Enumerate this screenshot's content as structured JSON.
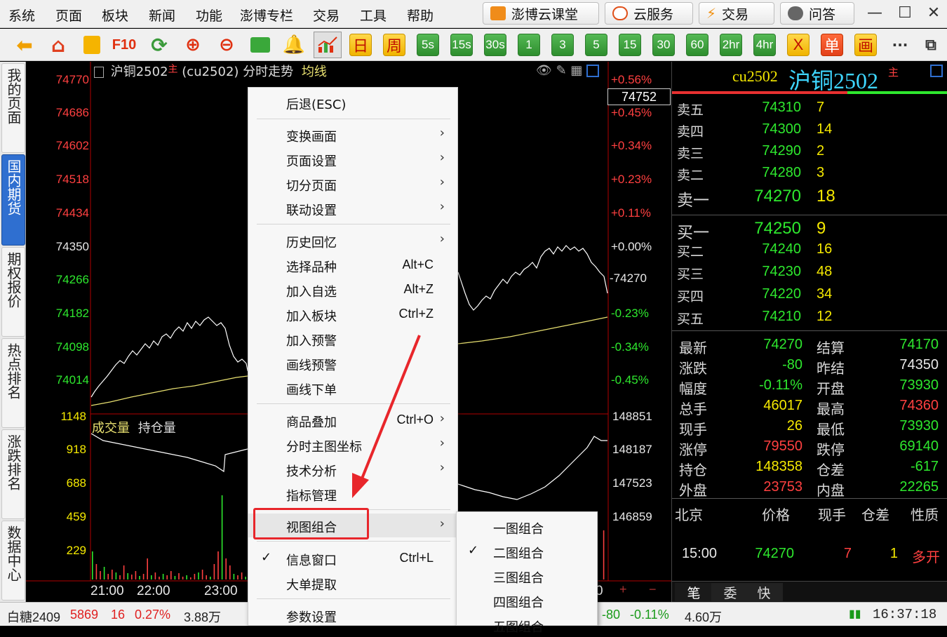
{
  "menubar": {
    "items": [
      "系统",
      "页面",
      "板块",
      "新闻",
      "功能",
      "澎博专栏",
      "交易",
      "工具",
      "帮助"
    ],
    "buttons": [
      "澎博云课堂",
      "云服务",
      "交易",
      "问答"
    ]
  },
  "toolbar": {
    "f10": "F10",
    "periods": [
      "日",
      "周",
      "5s",
      "15s",
      "30s",
      "1",
      "3",
      "5",
      "15",
      "30",
      "60",
      "2hr",
      "4hr"
    ],
    "icons_right": [
      "X",
      "单",
      "画"
    ],
    "more": "···"
  },
  "lefttabs": [
    "我的页面",
    "国内期货",
    "期权报价",
    "热点排名",
    "涨跌排名",
    "数据中心"
  ],
  "chart": {
    "title_prefix": "沪铜2502",
    "title_main_tag": "主",
    "title_suffix": "(cu2502) 分时走势",
    "avg_label": "均线",
    "price_labels": [
      "74770",
      "74686",
      "74602",
      "74518",
      "74434",
      "74350",
      "74266",
      "74182",
      "74098",
      "74014"
    ],
    "pct_labels": [
      "+0.56%",
      "+0.45%",
      "+0.34%",
      "+0.23%",
      "+0.11%",
      "+0.00%",
      "-0.23%",
      "-0.34%",
      "-0.45%"
    ],
    "current_price_box": "74752",
    "last_price_marker": "74270",
    "vol_title_a": "成交量",
    "vol_title_b": "持仓量",
    "vol_labels": [
      "1148",
      "918",
      "688",
      "459",
      "229"
    ],
    "oi_labels": [
      "148851",
      "148187",
      "147523",
      "146859"
    ],
    "time_labels": [
      "21:00",
      "22:00",
      "23:00"
    ],
    "time_label_right": "0",
    "plus_minus": [
      "+",
      "−"
    ]
  },
  "quote": {
    "code": "cu2502",
    "name": "沪铜2502",
    "main_tag": "主",
    "asks": [
      {
        "label": "卖五",
        "price": "74310",
        "qty": "7"
      },
      {
        "label": "卖四",
        "price": "74300",
        "qty": "14"
      },
      {
        "label": "卖三",
        "price": "74290",
        "qty": "2"
      },
      {
        "label": "卖二",
        "price": "74280",
        "qty": "3"
      },
      {
        "label": "卖一",
        "price": "74270",
        "qty": "18"
      }
    ],
    "bids": [
      {
        "label": "买一",
        "price": "74250",
        "qty": "9"
      },
      {
        "label": "买二",
        "price": "74240",
        "qty": "16"
      },
      {
        "label": "买三",
        "price": "74230",
        "qty": "48"
      },
      {
        "label": "买四",
        "price": "74220",
        "qty": "34"
      },
      {
        "label": "买五",
        "price": "74210",
        "qty": "12"
      }
    ],
    "stats": [
      {
        "l1": "最新",
        "v1": "74270",
        "c1": "#2ee82e",
        "l2": "结算",
        "v2": "74170",
        "c2": "#2ee82e"
      },
      {
        "l1": "涨跌",
        "v1": "-80",
        "c1": "#2ee82e",
        "l2": "昨结",
        "v2": "74350",
        "c2": "#e8e8e8"
      },
      {
        "l1": "幅度",
        "v1": "-0.11%",
        "c1": "#2ee82e",
        "l2": "开盘",
        "v2": "73930",
        "c2": "#2ee82e"
      },
      {
        "l1": "总手",
        "v1": "46017",
        "c1": "#f5e900",
        "l2": "最高",
        "v2": "74360",
        "c2": "#ff4040"
      },
      {
        "l1": "现手",
        "v1": "26",
        "c1": "#f5e900",
        "l2": "最低",
        "v2": "73930",
        "c2": "#2ee82e"
      },
      {
        "l1": "涨停",
        "v1": "79550",
        "c1": "#ff4040",
        "l2": "跌停",
        "v2": "69140",
        "c2": "#2ee82e"
      },
      {
        "l1": "持仓",
        "v1": "148358",
        "c1": "#f5e900",
        "l2": "仓差",
        "v2": "-617",
        "c2": "#2ee82e"
      },
      {
        "l1": "外盘",
        "v1": "23753",
        "c1": "#ff4040",
        "l2": "内盘",
        "v2": "22265",
        "c2": "#2ee82e"
      }
    ],
    "tick_header": [
      "北京",
      "价格",
      "现手",
      "仓差",
      "性质"
    ],
    "tick_row": {
      "time": "15:00",
      "price": "74270",
      "qty": "7",
      "oi": "1",
      "nature": "多开"
    },
    "bottom_tabs": [
      "笔",
      "委",
      "快"
    ]
  },
  "status": {
    "left_name": "白糖2409",
    "left_price": "5869",
    "left_change": "16",
    "left_pct": "0.27%",
    "left_vol": "3.88万",
    "mid_change": "-80",
    "mid_pct": "-0.11%",
    "mid_vol": "4.60万",
    "clock": "16:37:18"
  },
  "ctxmenu": {
    "items": [
      {
        "label": "后退(ESC)",
        "sc": "",
        "arrow": false,
        "check": false
      },
      {
        "label": "变换画面",
        "sc": "",
        "arrow": true,
        "check": false
      },
      {
        "label": "页面设置",
        "sc": "",
        "arrow": true,
        "check": false
      },
      {
        "label": "切分页面",
        "sc": "",
        "arrow": true,
        "check": false
      },
      {
        "label": "联动设置",
        "sc": "",
        "arrow": true,
        "check": false
      },
      {
        "label": "历史回忆",
        "sc": "",
        "arrow": true,
        "check": false
      },
      {
        "label": "选择品种",
        "sc": "Alt+C",
        "arrow": false,
        "check": false
      },
      {
        "label": "加入自选",
        "sc": "Alt+Z",
        "arrow": false,
        "check": false
      },
      {
        "label": "加入板块",
        "sc": "Ctrl+Z",
        "arrow": false,
        "check": false
      },
      {
        "label": "加入预警",
        "sc": "",
        "arrow": false,
        "check": false
      },
      {
        "label": "画线预警",
        "sc": "",
        "arrow": false,
        "check": false
      },
      {
        "label": "画线下单",
        "sc": "",
        "arrow": false,
        "check": false
      },
      {
        "label": "商品叠加",
        "sc": "Ctrl+O",
        "arrow": true,
        "check": false
      },
      {
        "label": "分时主图坐标",
        "sc": "",
        "arrow": true,
        "check": false
      },
      {
        "label": "技术分析",
        "sc": "",
        "arrow": true,
        "check": false
      },
      {
        "label": "指标管理",
        "sc": "",
        "arrow": false,
        "check": false
      },
      {
        "label": "视图组合",
        "sc": "",
        "arrow": true,
        "check": false
      },
      {
        "label": "信息窗口",
        "sc": "Ctrl+L",
        "arrow": false,
        "check": true
      },
      {
        "label": "大单提取",
        "sc": "",
        "arrow": false,
        "check": false
      },
      {
        "label": "参数设置",
        "sc": "",
        "arrow": false,
        "check": false
      }
    ]
  },
  "submenu": {
    "items": [
      {
        "label": "一图组合",
        "check": false
      },
      {
        "label": "二图组合",
        "check": true
      },
      {
        "label": "三图组合",
        "check": false
      },
      {
        "label": "四图组合",
        "check": false
      },
      {
        "label": "五图组合",
        "check": false
      }
    ]
  },
  "colors": {
    "up": "#ff4040",
    "down": "#2ee82e",
    "neutral": "#e8e8e8",
    "qty": "#f5e900",
    "accent": "#2f6fd0",
    "highlight": "#e8262b"
  }
}
